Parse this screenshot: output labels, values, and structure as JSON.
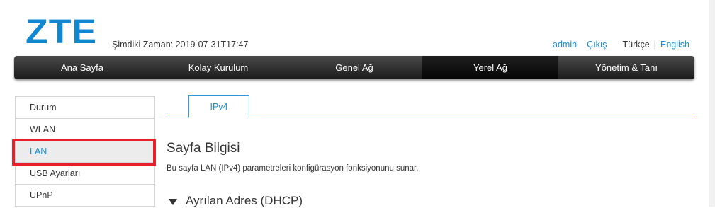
{
  "header": {
    "logo": "ZTE",
    "current_time": "Şimdiki Zaman: 2019-07-31T17:47",
    "admin": "admin",
    "logout": "Çıkış",
    "lang_current": "Türkçe",
    "lang_separator": "|",
    "lang_other": "English"
  },
  "nav": {
    "items": [
      {
        "label": "Ana Sayfa"
      },
      {
        "label": "Kolay Kurulum"
      },
      {
        "label": "Genel Ağ"
      },
      {
        "label": "Yerel Ağ"
      },
      {
        "label": "Yönetim & Tanı"
      }
    ],
    "active_index": 3
  },
  "sidebar": {
    "items": [
      {
        "label": "Durum"
      },
      {
        "label": "WLAN"
      },
      {
        "label": "LAN"
      },
      {
        "label": "USB Ayarları"
      },
      {
        "label": "UPnP"
      }
    ],
    "active_index": 2
  },
  "main": {
    "tab": "IPv4",
    "heading": "Sayfa Bilgisi",
    "description": "Bu sayfa LAN (IPv4) parametreleri konfigürasyon fonksiyonunu sunar.",
    "section_title": "Ayrılan Adres (DHCP)",
    "section_icon": "triangle-down-icon"
  },
  "colors": {
    "brand": "#0f87d3",
    "link": "#1a8fd6",
    "highlight": "#e8202c"
  }
}
